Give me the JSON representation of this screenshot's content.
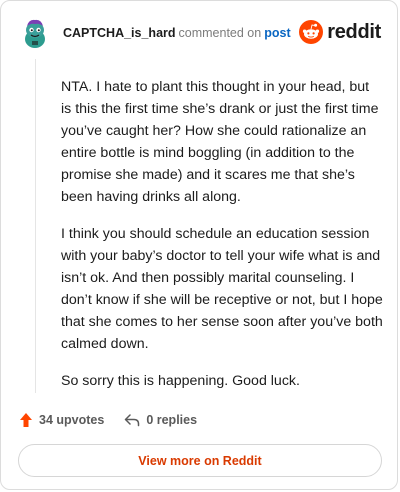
{
  "header": {
    "username": "CAPTCHA_is_hard",
    "action_text": "commented on",
    "post_link": "post",
    "brand_name": "reddit"
  },
  "comment": {
    "paragraphs": [
      "NTA. I hate to plant this thought in your head, but is this the first time she’s drank or just the first time you’ve caught her? How she could rationalize an entire bottle is mind boggling (in addition to the promise she made) and it scares me that she’s been having drinks all along.",
      "I think you should schedule an education session with your baby’s doctor to tell your wife what is and isn’t ok. And then possibly marital counseling. I don’t know if she will be receptive or not, but I hope that she comes to her sense soon after you’ve both calmed down.",
      "So sorry this is happening. Good luck."
    ]
  },
  "actions": {
    "upvotes": "34 upvotes",
    "replies": "0 replies"
  },
  "footer": {
    "view_more": "View more on Reddit"
  },
  "colors": {
    "brand": "#ff4500",
    "link": "#0a66c2",
    "view_more": "#d93a00"
  },
  "icons": {
    "avatar": "snoo-avatar-icon",
    "brand": "reddit-logo-icon",
    "upvote": "upvote-arrow-icon",
    "reply": "reply-arrow-icon"
  }
}
